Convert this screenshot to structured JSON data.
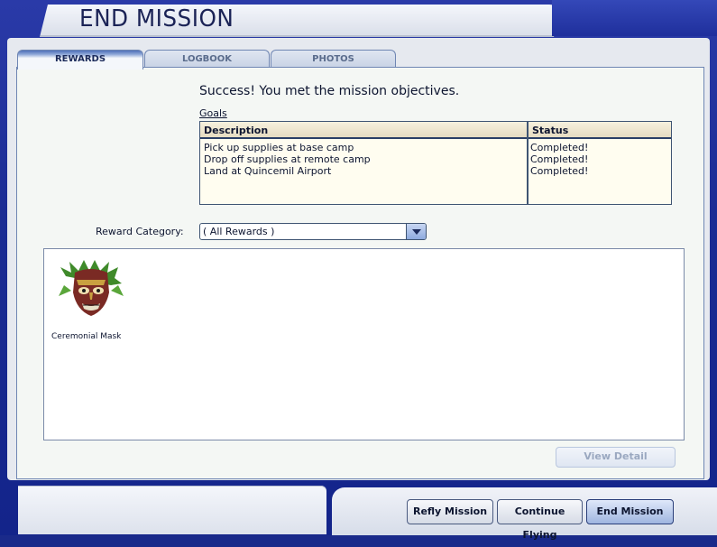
{
  "window": {
    "title": "END MISSION"
  },
  "tabs": [
    {
      "label": "REWARDS",
      "active": true
    },
    {
      "label": "LOGBOOK",
      "active": false
    },
    {
      "label": "PHOTOS",
      "active": false
    }
  ],
  "result": {
    "message": "Success! You met the mission objectives."
  },
  "goals": {
    "label": "Goals",
    "columns": [
      "Description",
      "Status"
    ],
    "rows": [
      {
        "description": "Pick up supplies at base camp",
        "status": "Completed!"
      },
      {
        "description": "Drop off supplies at remote camp",
        "status": "Completed!"
      },
      {
        "description": "Land at Quincemil Airport",
        "status": "Completed!"
      }
    ]
  },
  "reward_category": {
    "label": "Reward Category:",
    "selected": "( All Rewards )"
  },
  "rewards": [
    {
      "name": "Ceremonial Mask",
      "icon": "ceremonial-mask-icon"
    }
  ],
  "buttons": {
    "view_detail": "View Detail",
    "refly": "Refly Mission",
    "continue": "Continue Flying",
    "end": "End Mission"
  },
  "colors": {
    "frame": "#1b2c94",
    "panel": "#f4f7f4",
    "accent": "#2b3f7a"
  }
}
